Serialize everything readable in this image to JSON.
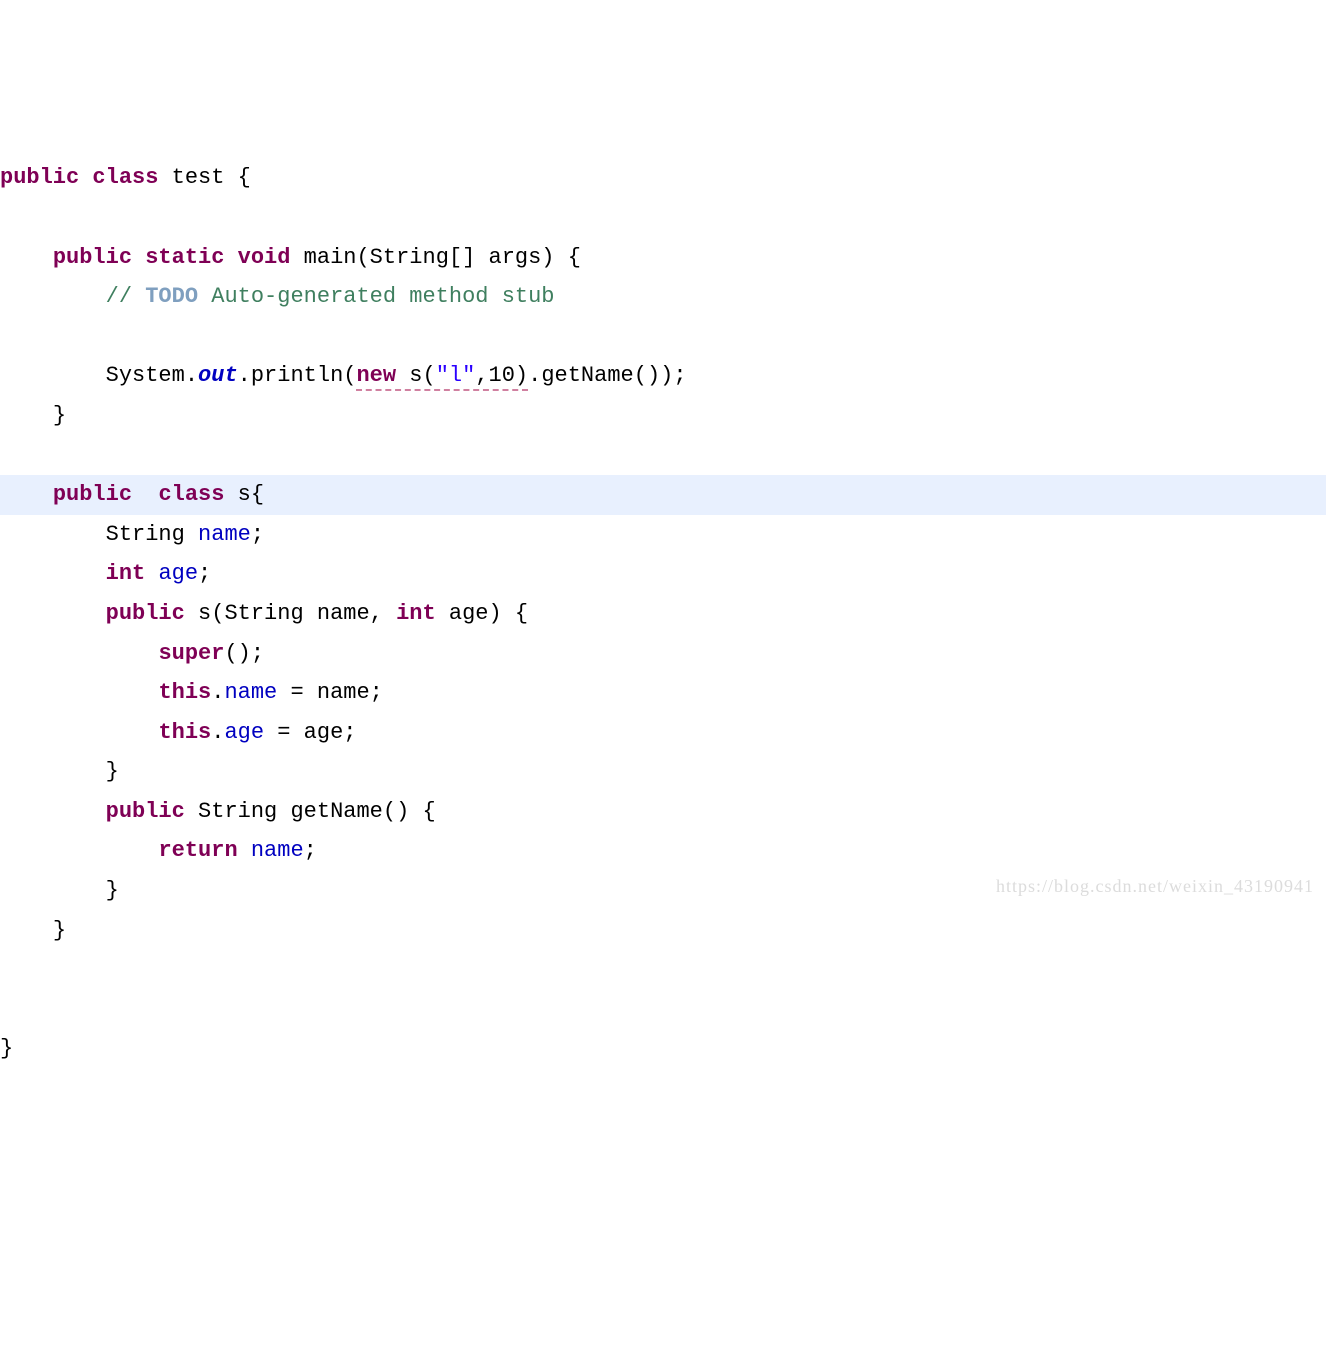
{
  "code": {
    "l1": {
      "kw1": "public",
      "kw2": "class",
      "name": "test",
      "brace": " {"
    },
    "l3": {
      "kw1": "public",
      "kw2": "static",
      "kw3": "void",
      "name": "main(String[] args) {"
    },
    "l4": {
      "slashes": "// ",
      "todo": "TODO",
      "rest": " Auto-generated method stub"
    },
    "l6": {
      "pre": "System.",
      "out": "out",
      "p1": ".println(",
      "u1": "new",
      "u2": " s(",
      "str": "\"l\"",
      "u3": ",10)",
      "post": ".getName());"
    },
    "l7": {
      "brace": "}"
    },
    "l9": {
      "kw1": "public",
      "sp": "  ",
      "kw2": "class",
      "name": " s{"
    },
    "l10": {
      "type": "String ",
      "name": "name",
      "semi": ";"
    },
    "l11": {
      "kw": "int",
      "sp": " ",
      "name": "age",
      "semi": ";"
    },
    "l12": {
      "kw1": "public",
      "rest": " s(String name, ",
      "kw2": "int",
      "rest2": " age) {"
    },
    "l13": {
      "kw": "super",
      "rest": "();"
    },
    "l14": {
      "kw": "this",
      "dot": ".",
      "fld": "name",
      "rest": " = name;"
    },
    "l15": {
      "kw": "this",
      "dot": ".",
      "fld": "age",
      "rest": " = age;"
    },
    "l16": {
      "brace": "}"
    },
    "l17": {
      "kw": "public",
      "rest": " String getName() {"
    },
    "l18": {
      "kw": "return",
      "sp": " ",
      "fld": "name",
      "semi": ";"
    },
    "l19": {
      "brace": "}"
    },
    "l20": {
      "brace": "}"
    },
    "l22": {
      "brace": "}"
    }
  },
  "watermark": "https://blog.csdn.net/weixin_43190941"
}
